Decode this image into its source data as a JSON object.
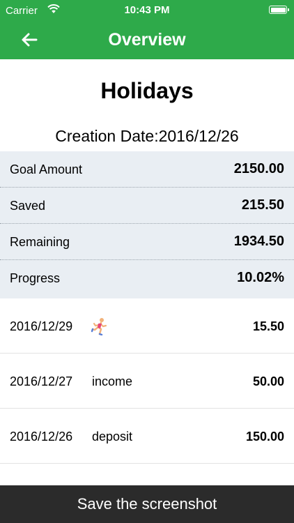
{
  "status_bar": {
    "carrier": "Carrier",
    "time": "10:43 PM",
    "wifi_icon": "wifi-icon",
    "battery_icon": "battery-icon"
  },
  "nav": {
    "title": "Overview",
    "back_icon": "back-arrow-icon",
    "color": "#2eaa4a"
  },
  "goal": {
    "title": "Holidays",
    "creation_label": "Creation Date:",
    "creation_date": "2016/12/26"
  },
  "summary": [
    {
      "label": "Goal Amount",
      "value": "2150.00"
    },
    {
      "label": "Saved",
      "value": "215.50"
    },
    {
      "label": "Remaining",
      "value": "1934.50"
    },
    {
      "label": "Progress",
      "value": "10.02%"
    }
  ],
  "transactions": [
    {
      "date": "2016/12/29",
      "description": "",
      "icon": "runner-icon",
      "amount": "15.50"
    },
    {
      "date": "2016/12/27",
      "description": "income",
      "amount": "50.00"
    },
    {
      "date": "2016/12/26",
      "description": "deposit",
      "amount": "150.00"
    }
  ],
  "footer": {
    "save_label": "Save the screenshot",
    "color": "#2b2b2b"
  }
}
